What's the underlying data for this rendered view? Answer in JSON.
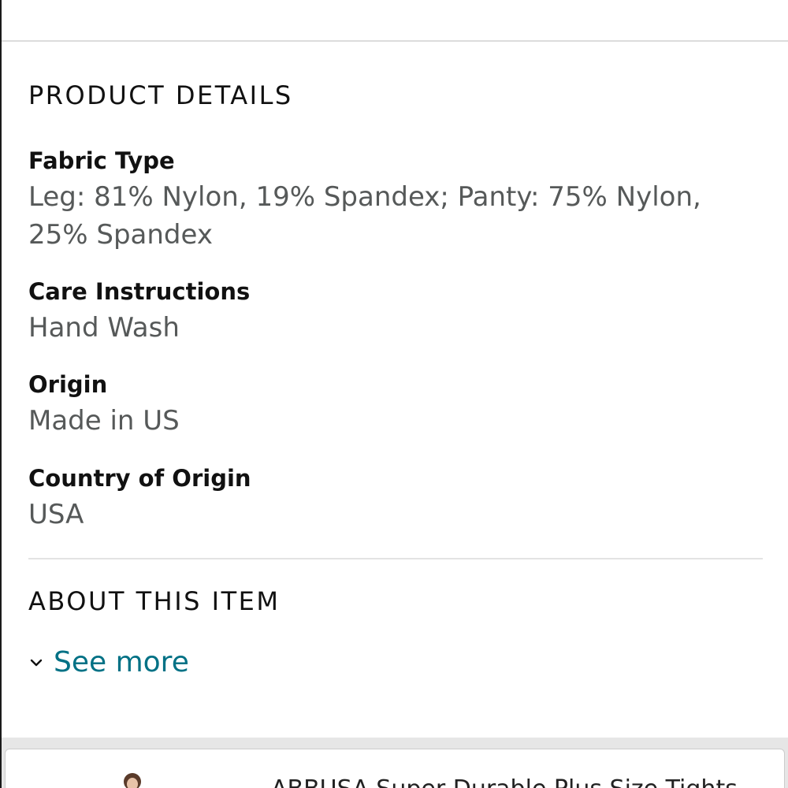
{
  "sections": {
    "product_details": {
      "title": "PRODUCT DETAILS",
      "items": [
        {
          "label": "Fabric Type",
          "value_line1": "Leg: 81% Nylon, 19% Spandex; Panty: 75% Nylon,",
          "value_line2": "25% Spandex"
        },
        {
          "label": "Care Instructions",
          "value": "Hand Wash"
        },
        {
          "label": "Origin",
          "value": "Made in US"
        },
        {
          "label": "Country of Origin",
          "value": "USA"
        }
      ]
    },
    "about": {
      "title": "ABOUT THIS ITEM",
      "see_more_label": "See more",
      "see_more_icon": "chevron-down-icon"
    }
  },
  "related_card": {
    "title_partial": "ABBUSA Super Durable Plus Size Tights"
  },
  "colors": {
    "link": "#007185",
    "label": "#111111",
    "value": "#565959"
  }
}
